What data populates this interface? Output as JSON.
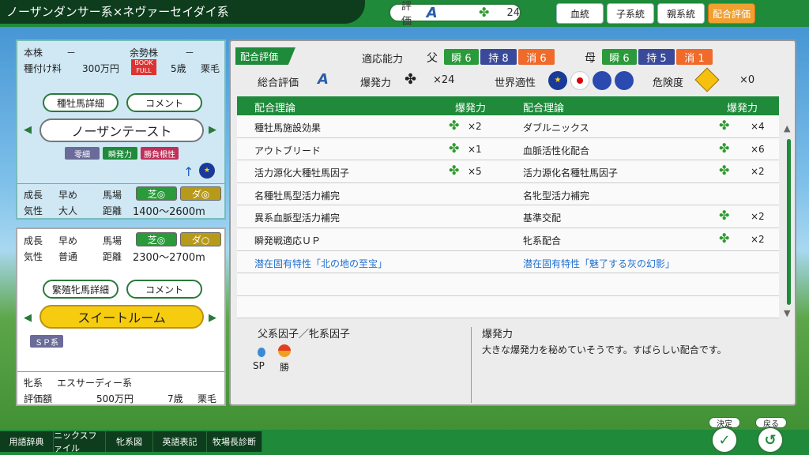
{
  "header": {
    "title": "ノーザンダンサー系×ネヴァーセイダイ系",
    "rating_label": "評価",
    "rating_grade": "A",
    "clover_count": "24",
    "tabs": [
      "血統",
      "子系統",
      "親系統",
      "配合評価"
    ]
  },
  "sire": {
    "label_main": "本株",
    "val_main": "－",
    "label_sub": "余勢株",
    "val_sub": "－",
    "fee_label": "種付け料",
    "fee": "300万円",
    "book": "BOOK FULL",
    "age": "5歳",
    "coat": "栗毛",
    "detail_btn": "種牡馬詳細",
    "comment_btn": "コメント",
    "name": "ノーザンテースト",
    "tags": [
      "零細",
      "瞬発力",
      "勝負根性"
    ],
    "growth_label": "成長",
    "growth": "早め",
    "track_label": "馬場",
    "turf": "芝◎",
    "dirt": "ダ◎",
    "temper_label": "気性",
    "temper": "大人",
    "dist_label": "距離",
    "dist": "1400〜2600m"
  },
  "mare": {
    "growth_label": "成長",
    "growth": "早め",
    "track_label": "馬場",
    "turf": "芝◎",
    "dirt": "ダ○",
    "temper_label": "気性",
    "temper": "普通",
    "dist_label": "距離",
    "dist": "2300〜2700m",
    "detail_btn": "繁殖牝馬詳細",
    "comment_btn": "コメント",
    "name": "スイートルーム",
    "tag": "ＳＰ系",
    "line_label": "牝系",
    "line": "エスサーディー系",
    "value_label": "評価額",
    "value": "500万円",
    "age": "7歳",
    "coat": "栗毛"
  },
  "eval": {
    "tag": "配合評価",
    "aptitude_label": "適応能力",
    "sire_label": "父",
    "sire_stats": [
      "瞬 6",
      "持 8",
      "消 6"
    ],
    "dam_label": "母",
    "dam_stats": [
      "瞬 6",
      "持 5",
      "消 1"
    ],
    "overall_label": "総合評価",
    "overall": "A",
    "burst_label": "爆発力",
    "burst": "×24",
    "world_label": "世界適性",
    "danger_label": "危険度",
    "danger": "×0"
  },
  "table": {
    "h1": "配合理論",
    "h2": "爆発力",
    "h3": "配合理論",
    "h4": "爆発力",
    "left": [
      {
        "name": "種牡馬施設効果",
        "val": "×2"
      },
      {
        "name": "アウトブリード",
        "val": "×1"
      },
      {
        "name": "活力源化大種牡馬因子",
        "val": "×5"
      },
      {
        "name": "名種牡馬型活力補完",
        "val": ""
      },
      {
        "name": "異系血脈型活力補完",
        "val": ""
      },
      {
        "name": "瞬発戦適応ＵＰ",
        "val": ""
      },
      {
        "name": "潜在固有特性「北の地の至宝」",
        "val": ""
      }
    ],
    "right": [
      {
        "name": "ダブルニックス",
        "val": "×4"
      },
      {
        "name": "血脈活性化配合",
        "val": "×6"
      },
      {
        "name": "活力源化名種牡馬因子",
        "val": "×2"
      },
      {
        "name": "名牝型活力補完",
        "val": ""
      },
      {
        "name": "基準交配",
        "val": "×2"
      },
      {
        "name": "牝系配合",
        "val": "×2"
      },
      {
        "name": "潜在固有特性「魅了する灰の幻影」",
        "val": ""
      }
    ]
  },
  "factors": {
    "title": "父系因子／牝系因子",
    "f1": "SP",
    "f2": "勝"
  },
  "burst_desc": {
    "title": "爆発力",
    "text": "大きな爆発力を秘めていそうです。すばらしい配合です。"
  },
  "footer": {
    "items": [
      "用語辞典",
      "ニックスファイル",
      "牝系図",
      "英語表記",
      "牧場長診断"
    ],
    "ok": "決定",
    "back": "戻る"
  }
}
